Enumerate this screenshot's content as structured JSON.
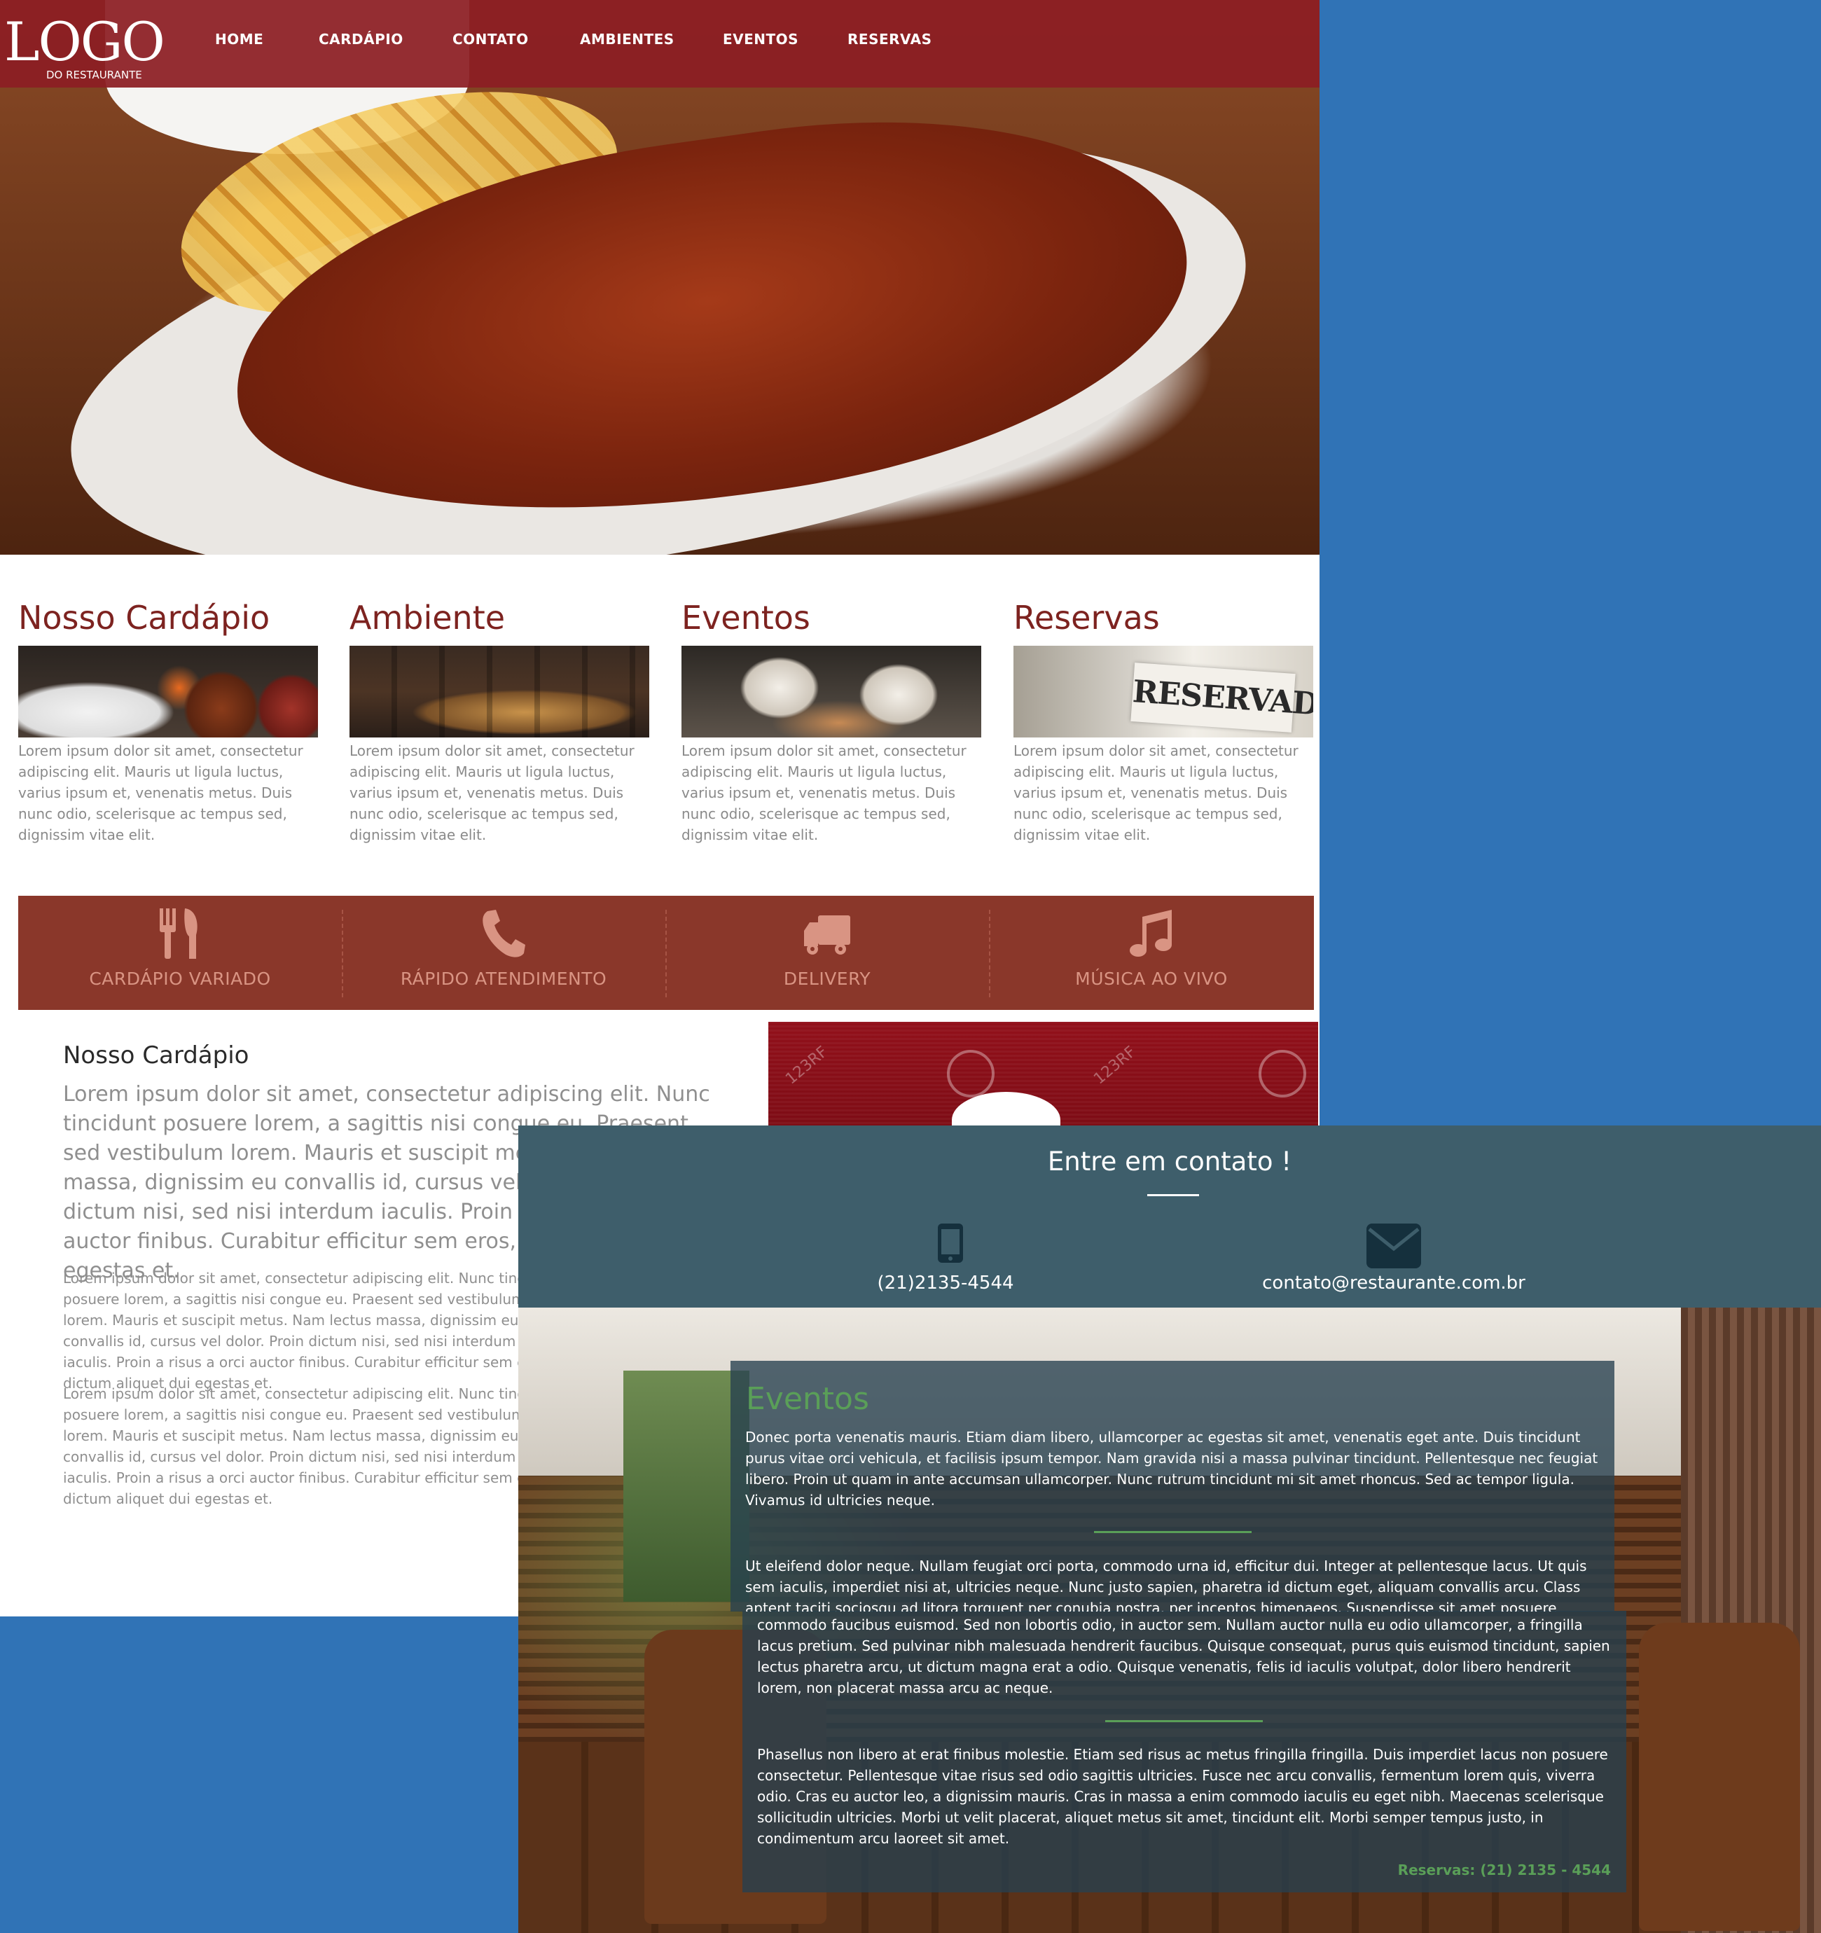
{
  "nav": {
    "logo_main": "LOGO",
    "logo_sub": "DO RESTAURANTE",
    "links": [
      "HOME",
      "CARDÁPIO",
      "CONTATO",
      "AMBIENTES",
      "EVENTOS",
      "RESERVAS"
    ]
  },
  "cards": [
    {
      "title": "Nosso Cardápio",
      "text": "Lorem ipsum dolor sit amet, consectetur adipiscing elit. Mauris ut ligula luctus, varius ipsum et, venenatis metus. Duis nunc odio, scelerisque ac tempus sed, dignissim vitae elit."
    },
    {
      "title": "Ambiente",
      "text": "Lorem ipsum dolor sit amet, consectetur adipiscing elit. Mauris ut ligula luctus, varius ipsum et, venenatis metus. Duis nunc odio, scelerisque ac tempus sed, dignissim vitae elit."
    },
    {
      "title": "Eventos",
      "text": "Lorem ipsum dolor sit amet, consectetur adipiscing elit. Mauris ut ligula luctus, varius ipsum et, venenatis metus. Duis nunc odio, scelerisque ac tempus sed, dignissim vitae elit."
    },
    {
      "title": "Reservas",
      "text": "Lorem ipsum dolor sit amet, consectetur adipiscing elit. Mauris ut ligula luctus, varius ipsum et, venenatis metus. Duis nunc odio, scelerisque ac tempus sed, dignissim vitae elit.",
      "image_sign": "RESERVADO"
    }
  ],
  "features": [
    {
      "label": "CARDÁPIO VARIADO",
      "icon": "cutlery-icon"
    },
    {
      "label": "RÁPIDO ATENDIMENTO",
      "icon": "phone-icon"
    },
    {
      "label": "DELIVERY",
      "icon": "truck-icon"
    },
    {
      "label": "MÚSICA AO VIVO",
      "icon": "music-icon"
    }
  ],
  "about": {
    "title": "Nosso Cardápio",
    "lead": "Lorem ipsum dolor sit amet, consectetur adipiscing elit. Nunc tincidunt posuere lorem, a sagittis nisi congue eu. Praesent sed vestibulum lorem. Mauris et suscipit metus. Nam lectus massa, dignissim eu convallis id, cursus vel dolor. Proin dictum nisi, sed nisi interdum iaculis. Proin a risus a orci auctor finibus. Curabitur efficitur sem eros, dictum aliquet dui egestas et.",
    "p1": "Lorem ipsum dolor sit amet, consectetur adipiscing elit. Nunc tincidunt posuere lorem, a sagittis nisi congue eu. Praesent sed vestibulum lorem. Mauris et suscipit metus. Nam lectus massa, dignissim eu convallis id, cursus vel dolor. Proin dictum nisi, sed nisi interdum iaculis. Proin a risus a orci auctor finibus. Curabitur efficitur sem eros, dictum aliquet dui egestas et.",
    "p2": "Lorem ipsum dolor sit amet, consectetur adipiscing elit. Nunc tincidunt posuere lorem, a sagittis nisi congue eu. Praesent sed vestibulum lorem. Mauris et suscipit metus. Nam lectus massa, dignissim eu convallis id, cursus vel dolor. Proin dictum nisi, sed nisi interdum iaculis. Proin a risus a orci auctor finibus. Curabitur efficitur sem eros, dictum aliquet dui egestas et."
  },
  "promo": {
    "watermark": "123RF"
  },
  "contact": {
    "title": "Entre em contato !",
    "phone": "(21)2135-4544",
    "email": "contato@restaurante.com.br"
  },
  "events": {
    "title": "Eventos",
    "p1": "Donec porta venenatis mauris. Etiam diam libero, ullamcorper ac egestas sit amet, venenatis eget ante. Duis tincidunt purus vitae orci vehicula, et facilisis ipsum tempor. Nam gravida nisi a massa pulvinar tincidunt. Pellentesque nec feugiat libero. Proin ut quam in ante accumsan ullamcorper. Nunc rutrum tincidunt mi sit amet rhoncus. Sed ac tempor ligula. Vivamus id ultricies neque.",
    "p2": "Ut eleifend dolor neque. Nullam feugiat orci porta, commodo urna id, efficitur dui. Integer at pellentesque lacus. Ut quis sem iaculis, imperdiet nisi at, ultricies neque. Nunc justo sapien, pharetra id dictum eget, aliquam convallis arcu. Class aptent taciti sociosqu ad litora torquent per conubia nostra, per inceptos himenaeos. Suspendisse sit amet posuere mauris.",
    "p3": "commodo faucibus euismod. Sed non lobortis odio, in auctor sem. Nullam auctor nulla eu odio ullamcorper, a fringilla lacus pretium. Sed pulvinar nibh malesuada hendrerit faucibus. Quisque consequat, purus quis euismod tincidunt, sapien lectus pharetra arcu, ut dictum magna erat a odio. Quisque venenatis, felis id iaculis volutpat, dolor libero hendrerit lorem, non placerat massa arcu ac neque.",
    "p4": "Phasellus non libero at erat finibus molestie. Etiam sed risus ac metus fringilla fringilla. Duis imperdiet lacus non posuere consectetur. Pellentesque vitae risus sed odio sagittis ultricies. Fusce nec arcu convallis, fermentum lorem quis, viverra odio. Cras eu auctor leo, a dignissim mauris. Cras in massa a enim commodo iaculis eu eget nibh. Maecenas scelerisque sollicitudin ultricies. Morbi ut velit placerat, aliquet metus sit amet, tincidunt elit. Morbi semper tempus justo, in condimentum arcu laoreet sit amet.",
    "reservas": "Reservas: (21) 2135 - 4544"
  },
  "colors": {
    "nav_bg": "#8c1d23",
    "accent_red": "#7d2320",
    "feature_bar": "#8a372a",
    "contact_bg": "#3e5e6b",
    "events_green": "#5a9f58",
    "canvas_blue": "#3073b6"
  }
}
